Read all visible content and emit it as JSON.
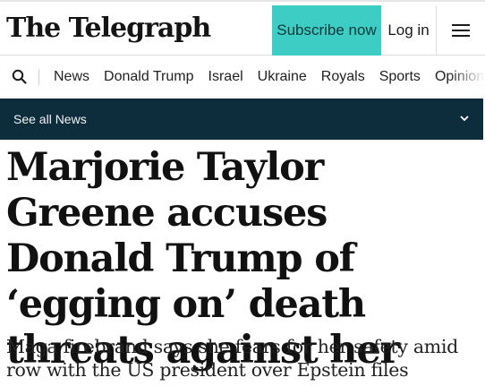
{
  "header": {
    "logo_text": "The Telegraph",
    "subscribe_label": "Subscribe now",
    "login_label": "Log in",
    "menu_icon": "hamburger-icon",
    "subscribe_color": "#3dcdc5"
  },
  "nav": {
    "search_icon": "search-icon",
    "items": [
      "News",
      "Donald Trump",
      "Israel",
      "Ukraine",
      "Royals",
      "Sports",
      "Opinion"
    ]
  },
  "section": {
    "label": "See all News",
    "chevron_icon": "chevron-down-icon",
    "background": "#0d2c3c"
  },
  "article": {
    "headline": "Marjorie Taylor Greene accuses Donald Trump of ‘egging on’ death threats against her",
    "standfirst": "Maga firebrand says she fears for her safety amid row with the US president over Epstein files"
  }
}
